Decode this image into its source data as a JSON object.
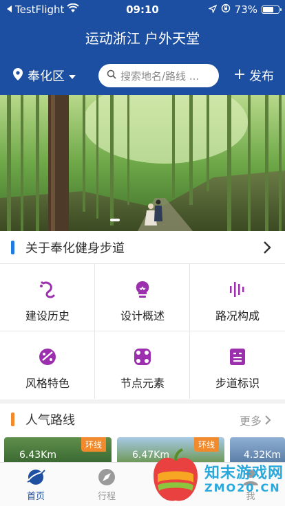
{
  "status": {
    "carrier": "TestFlight",
    "time": "09:10",
    "battery": "73%",
    "battery_level": 0.73
  },
  "header": {
    "title": "运动浙江 户外天堂",
    "location": "奉化区",
    "search_placeholder": "搜索地名/路线 ...",
    "publish": "发布"
  },
  "about": {
    "title": "关于奉化健身步道",
    "items": [
      {
        "label": "建设历史",
        "icon": "footprint-icon"
      },
      {
        "label": "设计概述",
        "icon": "lightbulb-icon"
      },
      {
        "label": "路况构成",
        "icon": "bars-icon"
      },
      {
        "label": "风格特色",
        "icon": "palette-icon"
      },
      {
        "label": "节点元素",
        "icon": "nodes-icon"
      },
      {
        "label": "步道标识",
        "icon": "signboard-icon"
      }
    ],
    "icon_color": "#9b2fae"
  },
  "popular": {
    "title": "人气路线",
    "more": "更多",
    "cards": [
      {
        "distance": "6.43Km",
        "tag": "环线"
      },
      {
        "distance": "6.47Km",
        "tag": "环线"
      },
      {
        "distance": "4.32Km",
        "tag": ""
      }
    ]
  },
  "tabs": [
    {
      "label": "首页"
    },
    {
      "label": "行程"
    },
    {
      "label": ""
    },
    {
      "label": "我"
    }
  ],
  "watermark": {
    "name": "知末游戏网",
    "domain": "ZMO20.CN"
  },
  "colors": {
    "header": "#1c4fa1",
    "accent_blue": "#1e7be0",
    "accent_orange": "#f08a2c"
  }
}
